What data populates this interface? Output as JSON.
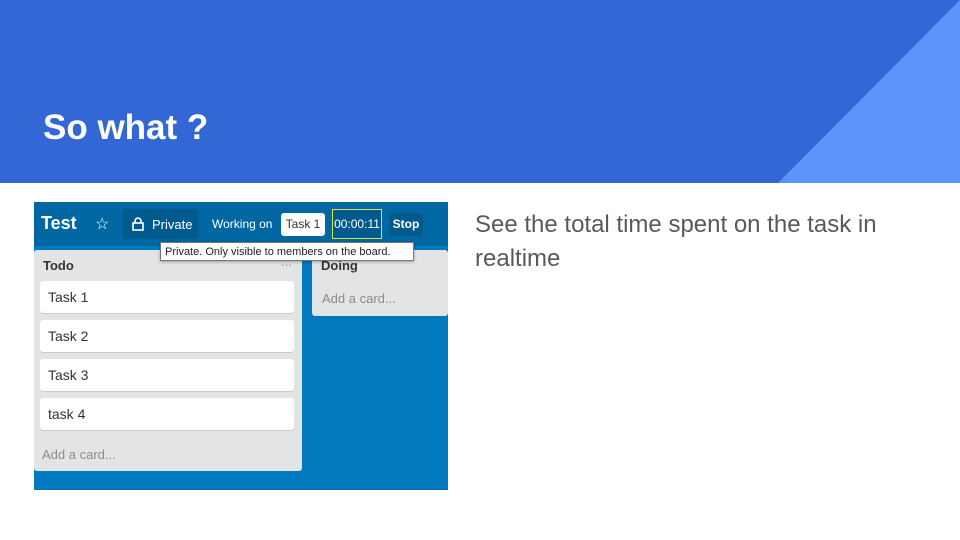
{
  "slide": {
    "title": "So what ?",
    "description": "See the total time spent on the task in realtime",
    "colors": {
      "header": "#3367d6",
      "triangle": "#5b95f9",
      "background": "#ffffff"
    }
  },
  "board": {
    "name": "Test",
    "star_icon": "star-icon",
    "visibility_label": "Private",
    "lock_icon": "lock-icon",
    "working_on_label": "Working on",
    "current_task": "Task 1",
    "timer": "00:00:11",
    "stop_label": "Stop",
    "tooltip": "Private. Only visible to members on the board.",
    "colors": {
      "board_bg": "#0079bf",
      "topbar": "#0067a3",
      "list_bg": "#e2e4e6"
    },
    "lists": [
      {
        "title": "Todo",
        "menu": "...",
        "cards": [
          "Task 1",
          "Task 2",
          "Task 3",
          "task 4"
        ],
        "add_card": "Add a card..."
      },
      {
        "title": "Doing",
        "cards": [],
        "add_card": "Add a card..."
      }
    ]
  }
}
